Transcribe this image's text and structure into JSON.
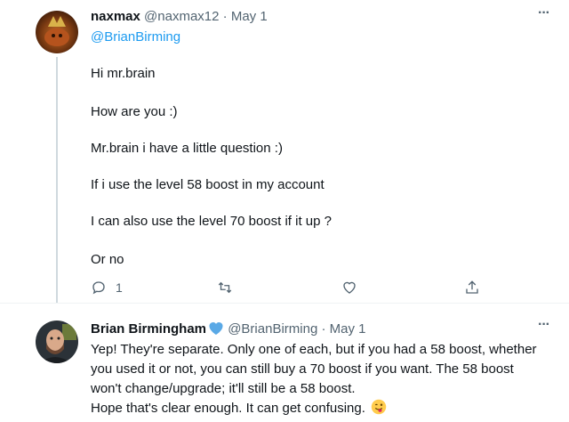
{
  "tweet1": {
    "name": "naxmax",
    "handle": "@naxmax12",
    "separator": "·",
    "date": "May 1",
    "more": "···",
    "mention": "@BrianBirming",
    "lines": [
      "Hi mr.brain",
      "How are you :)",
      "Mr.brain i have a little question :)",
      "If i use the level 58 boost in my account",
      "I can also use the level 70 boost if it up ?",
      "Or no"
    ],
    "reply_count": "1",
    "icons": [
      "reply-icon",
      "retweet-icon",
      "like-icon",
      "share-icon"
    ]
  },
  "tweet2": {
    "name": "Brian Birmingham",
    "handle": "@BrianBirming",
    "separator": "·",
    "date": "May 1",
    "more": "···",
    "lines": [
      "Yep! They're separate. Only one of each, but if you had a 58 boost, whether",
      "you used it or not, you can still buy a 70 boost if you want. The 58 boost",
      "won't change/upgrade; it'll still be a 58 boost.",
      "Hope that's clear enough.  It can get confusing."
    ],
    "badge": "heart-verified-icon",
    "emoji": "winking-face-with-tongue-icon"
  },
  "colors": {
    "text": "#0f1419",
    "muted": "#536471",
    "link": "#1d9bf0",
    "thread_line": "#cfd9de"
  }
}
